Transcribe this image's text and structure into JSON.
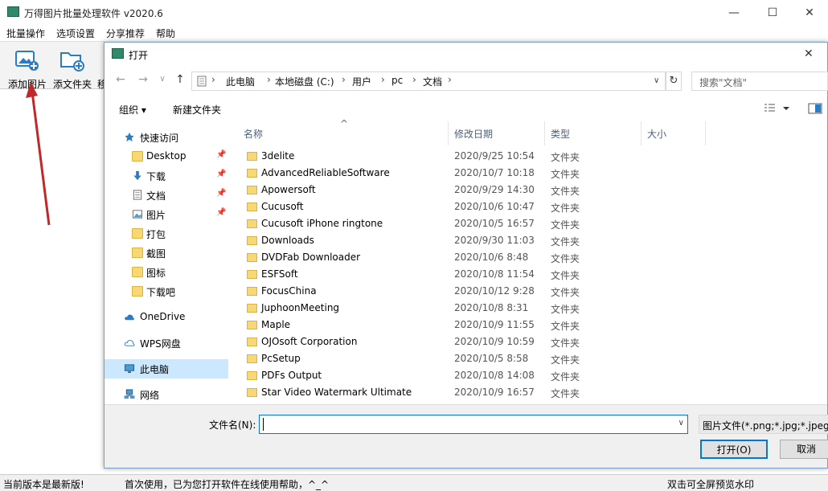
{
  "app": {
    "title": "万得图片批量处理软件 v2020.6",
    "window_controls": {
      "minimize": "—",
      "maximize": "☐",
      "close": "✕"
    }
  },
  "menu": [
    "批量操作",
    "选项设置",
    "分享推荐",
    "帮助"
  ],
  "toolbar": {
    "add_image": "添加图片",
    "add_folder": "添文件夹",
    "partial": "移"
  },
  "status": {
    "left": "当前版本是最新版!",
    "middle": "首次使用，已为您打开软件在线使用帮助，^_^",
    "right": "双击可全屏预览水印"
  },
  "dialog": {
    "title": "打开",
    "close": "✕",
    "nav": {
      "back": "←",
      "forward": "→",
      "recent": "∨",
      "up": "↑"
    },
    "breadcrumb": [
      "此电脑",
      "本地磁盘 (C:)",
      "用户",
      "pc",
      "文档"
    ],
    "refresh": "↻",
    "search_placeholder": "搜索\"文档\"",
    "organize": "组织 ▾",
    "new_folder": "新建文件夹",
    "sidebar": [
      {
        "label": "快速访问",
        "icon": "star-icon",
        "pinned": false
      },
      {
        "label": "Desktop",
        "icon": "folder-icon",
        "pinned": true
      },
      {
        "label": "下载",
        "icon": "download-icon",
        "pinned": true
      },
      {
        "label": "文档",
        "icon": "document-icon",
        "pinned": true
      },
      {
        "label": "图片",
        "icon": "picture-icon",
        "pinned": true
      },
      {
        "label": "打包",
        "icon": "folder-icon",
        "pinned": false
      },
      {
        "label": "截图",
        "icon": "folder-icon",
        "pinned": false
      },
      {
        "label": "图标",
        "icon": "folder-icon",
        "pinned": false
      },
      {
        "label": "下载吧",
        "icon": "folder-icon",
        "pinned": false
      },
      {
        "label": "OneDrive",
        "icon": "cloud-icon",
        "pinned": false
      },
      {
        "label": "WPS网盘",
        "icon": "cloud-outline-icon",
        "pinned": false
      },
      {
        "label": "此电脑",
        "icon": "computer-icon",
        "pinned": false,
        "selected": true
      },
      {
        "label": "网络",
        "icon": "network-icon",
        "pinned": false
      }
    ],
    "columns": [
      "名称",
      "修改日期",
      "类型",
      "大小"
    ],
    "files": [
      {
        "name": "3delite",
        "date": "2020/9/25 10:54",
        "type": "文件夹"
      },
      {
        "name": "AdvancedReliableSoftware",
        "date": "2020/10/7 10:18",
        "type": "文件夹"
      },
      {
        "name": "Apowersoft",
        "date": "2020/9/29 14:30",
        "type": "文件夹"
      },
      {
        "name": "Cucusoft",
        "date": "2020/10/6 10:47",
        "type": "文件夹"
      },
      {
        "name": "Cucusoft iPhone ringtone",
        "date": "2020/10/5 16:57",
        "type": "文件夹"
      },
      {
        "name": "Downloads",
        "date": "2020/9/30 11:03",
        "type": "文件夹"
      },
      {
        "name": "DVDFab Downloader",
        "date": "2020/10/6 8:48",
        "type": "文件夹"
      },
      {
        "name": "ESFSoft",
        "date": "2020/10/8 11:54",
        "type": "文件夹"
      },
      {
        "name": "FocusChina",
        "date": "2020/10/12 9:28",
        "type": "文件夹"
      },
      {
        "name": "JuphoonMeeting",
        "date": "2020/10/8 8:31",
        "type": "文件夹"
      },
      {
        "name": "Maple",
        "date": "2020/10/9 11:55",
        "type": "文件夹"
      },
      {
        "name": "OJOsoft Corporation",
        "date": "2020/10/9 10:59",
        "type": "文件夹"
      },
      {
        "name": "PcSetup",
        "date": "2020/10/5 8:58",
        "type": "文件夹"
      },
      {
        "name": "PDFs Output",
        "date": "2020/10/8 14:08",
        "type": "文件夹"
      },
      {
        "name": "Star Video Watermark Ultimate",
        "date": "2020/10/9 16:57",
        "type": "文件夹"
      }
    ],
    "filename_label": "文件名(N):",
    "filename_value": "",
    "filetype": "图片文件(*.png;*.jpg;*.jpeg;*",
    "open_button": "打开(O)",
    "cancel_button": "取消"
  },
  "colors": {
    "accent": "#0078d7",
    "selection": "#cce8ff",
    "folder": "#f8d775",
    "arrow": "#c0282a"
  }
}
